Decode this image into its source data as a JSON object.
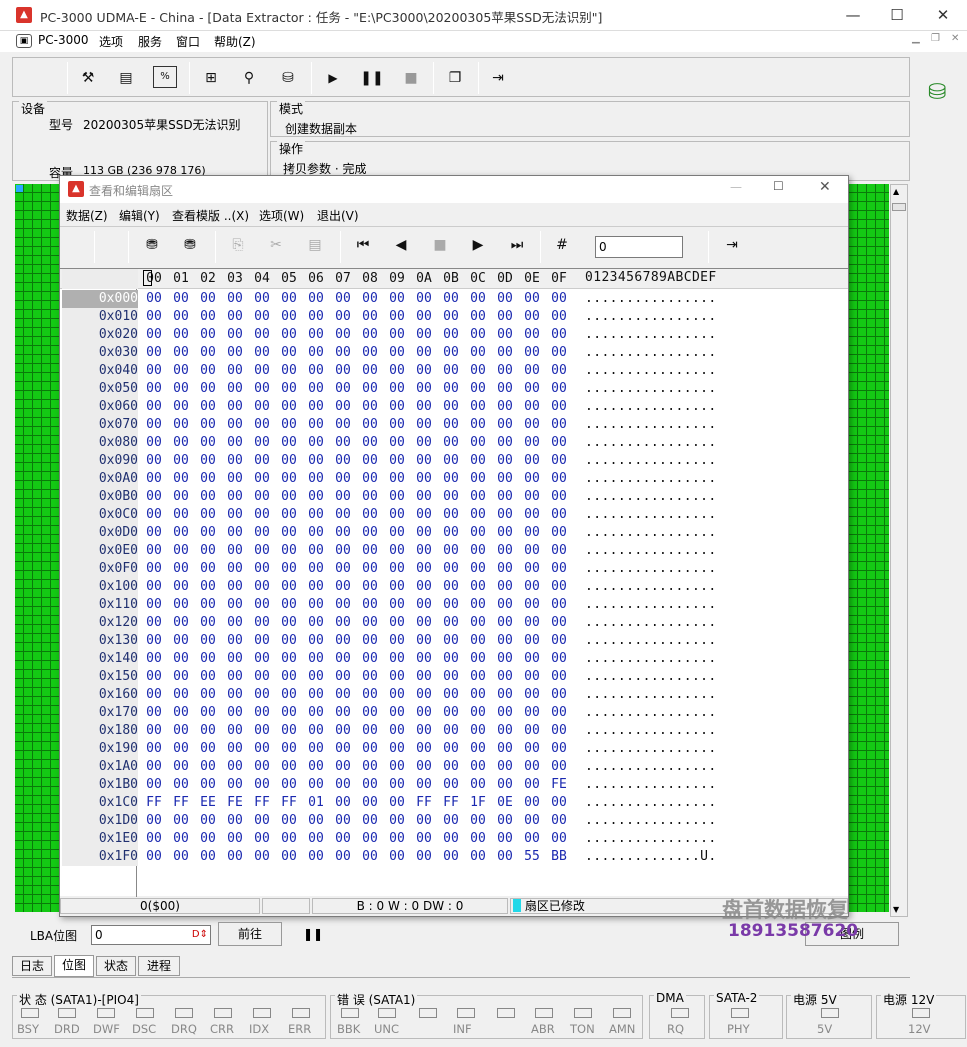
{
  "app": {
    "title": "PC-3000 UDMA-E - China - [Data Extractor : 任务 - \"E:\\PC3000\\20200305苹果SSD无法识别\"]",
    "logo_text": "PC-3000"
  },
  "menu": [
    "选项",
    "服务",
    "窗口",
    "帮助(Z)"
  ],
  "device": {
    "label": "设备",
    "model_label": "型号",
    "model_value": "20200305苹果SSD无法识别",
    "capacity_label": "容量",
    "capacity_value": "113 GB (236 978 176)"
  },
  "mode": {
    "label": "模式",
    "value": "创建数据副本"
  },
  "operation": {
    "label": "操作",
    "value": "拷贝参数 · 完成"
  },
  "editor": {
    "title": "查看和编辑扇区",
    "menu": [
      "数据(Z)",
      "编辑(Y)",
      "查看模版 ..(X)",
      "选项(W)",
      "退出(V)"
    ],
    "sector_input": "0",
    "header_hex": [
      "00",
      "01",
      "02",
      "03",
      "04",
      "05",
      "06",
      "07",
      "08",
      "09",
      "0A",
      "0B",
      "0C",
      "0D",
      "0E",
      "0F"
    ],
    "header_ascii": "0123456789ABCDEF",
    "offsets": [
      "0x000",
      "0x010",
      "0x020",
      "0x030",
      "0x040",
      "0x050",
      "0x060",
      "0x070",
      "0x080",
      "0x090",
      "0x0A0",
      "0x0B0",
      "0x0C0",
      "0x0D0",
      "0x0E0",
      "0x0F0",
      "0x100",
      "0x110",
      "0x120",
      "0x130",
      "0x140",
      "0x150",
      "0x160",
      "0x170",
      "0x180",
      "0x190",
      "0x1A0",
      "0x1B0",
      "0x1C0",
      "0x1D0",
      "0x1E0",
      "0x1F0"
    ],
    "rows_special": {
      "27": {
        "hex": [
          "00",
          "00",
          "00",
          "00",
          "00",
          "00",
          "00",
          "00",
          "00",
          "00",
          "00",
          "00",
          "00",
          "00",
          "00",
          "FE"
        ],
        "ascii": "................"
      },
      "28": {
        "hex": [
          "FF",
          "FF",
          "EE",
          "FE",
          "FF",
          "FF",
          "01",
          "00",
          "00",
          "00",
          "FF",
          "FF",
          "1F",
          "0E",
          "00",
          "00"
        ],
        "ascii": "................"
      },
      "31": {
        "hex": [
          "00",
          "00",
          "00",
          "00",
          "00",
          "00",
          "00",
          "00",
          "00",
          "00",
          "00",
          "00",
          "00",
          "00",
          "55",
          "BB"
        ],
        "ascii": "..............U."
      }
    },
    "default_hex": "00",
    "default_ascii": "................",
    "status": {
      "pos": "0($00)",
      "bw": "B : 0 W : 0 DW : 0",
      "modified": "扇区已修改"
    }
  },
  "lba": {
    "label": "LBA位图",
    "value": "0",
    "go_button": "前往",
    "legend_button": "图例"
  },
  "watermark": {
    "line1": "盘首数据恢复",
    "line2": "18913587620"
  },
  "tabs": [
    "日志",
    "位图",
    "状态",
    "进程"
  ],
  "status_groups": {
    "state": {
      "label": "状 态 (SATA1)-[PIO4]",
      "leds": [
        "BSY",
        "DRD",
        "DWF",
        "DSC",
        "DRQ",
        "CRR",
        "IDX",
        "ERR"
      ]
    },
    "error": {
      "label": "错 误 (SATA1)",
      "leds": [
        "BBK",
        "UNC",
        "",
        "INF",
        "",
        "ABR",
        "TON",
        "AMN"
      ]
    },
    "dma": {
      "label": "DMA",
      "leds": [
        "RQ"
      ]
    },
    "sata2": {
      "label": "SATA-2",
      "leds": [
        "PHY"
      ]
    },
    "p5": {
      "label": "电源 5V",
      "leds": [
        "5V"
      ]
    },
    "p12": {
      "label": "电源 12V",
      "leds": [
        "12V"
      ]
    }
  },
  "colors": {
    "green": "#14c914",
    "hex_blue": "#1a28b0",
    "title_red": "#d9342b"
  }
}
